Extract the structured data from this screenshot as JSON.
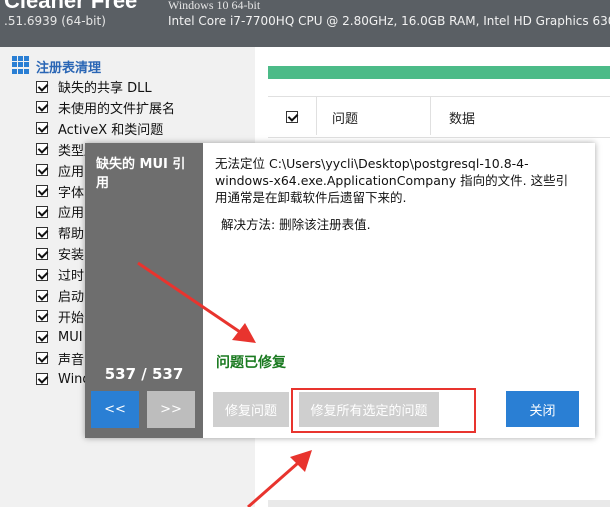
{
  "window": {
    "app_name": "Cleaner Free",
    "version": ".51.6939 (64-bit)",
    "os": "Windows 10 64-bit",
    "hardware": "Intel Core i7-7700HQ CPU @ 2.80GHz, 16.0GB RAM, Intel HD Graphics 630"
  },
  "sidebar": {
    "heading": "注册表清理",
    "options": [
      {
        "label": "缺失的共享 DLL"
      },
      {
        "label": "未使用的文件扩展名"
      },
      {
        "label": "ActiveX 和类问题"
      },
      {
        "label": "类型库"
      },
      {
        "label": "应用"
      },
      {
        "label": "字体"
      },
      {
        "label": "应用"
      },
      {
        "label": "帮助"
      },
      {
        "label": "安装"
      },
      {
        "label": "过时"
      },
      {
        "label": "启动"
      },
      {
        "label": "开始"
      },
      {
        "label": "MUI"
      },
      {
        "label": "声音"
      },
      {
        "label": "Windo"
      }
    ]
  },
  "table": {
    "col_issue": "问题",
    "col_data": "数据"
  },
  "dialog": {
    "issue_name": "缺失的 MUI 引用",
    "counter": "537 / 537",
    "prev_label": "<<",
    "next_label": ">>",
    "message": "无法定位 C:\\Users\\yycli\\Desktop\\postgresql-10.8-4-windows-x64.exe.ApplicationCompany 指向的文件. 这些引用通常是在卸载软件后遗留下来的.",
    "solution": "解决方法: 删除该注册表值.",
    "status": "问题已修复",
    "fix_label": "修复问题",
    "fix_all_label": "修复所有选定的问题",
    "close_label": "关闭"
  },
  "colors": {
    "accent_blue": "#2a7fd4",
    "progress_green": "#4cbb88",
    "status_green": "#1a7a20",
    "annotation_red": "#e8342e"
  }
}
